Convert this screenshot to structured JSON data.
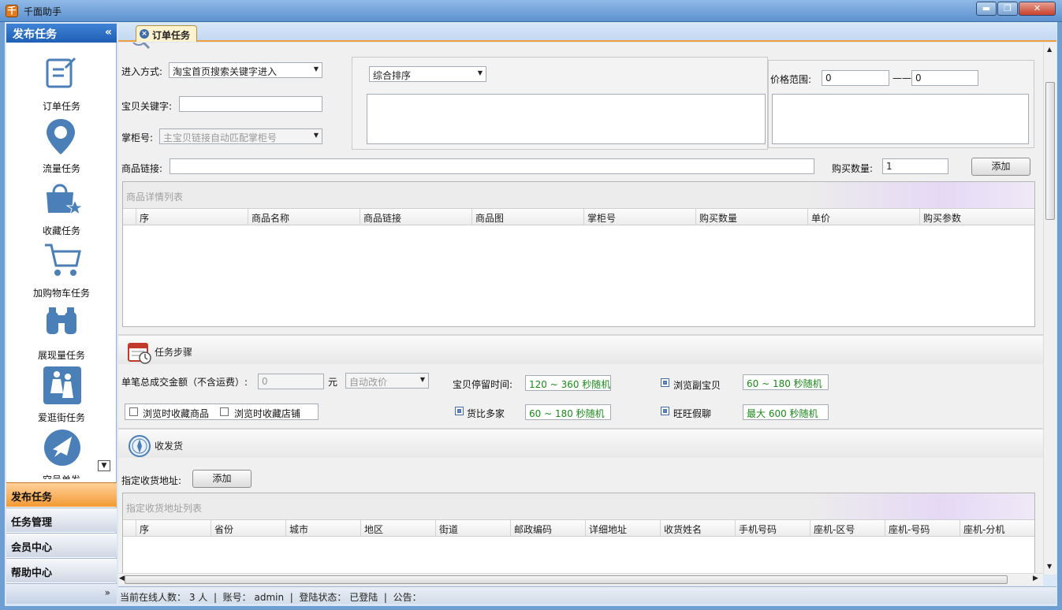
{
  "window": {
    "title": "千面助手",
    "icon_label": "千",
    "min": "▬",
    "max": "❐",
    "close": "✕"
  },
  "sidebar": {
    "header": "发布任务",
    "collapse": "«",
    "items": [
      {
        "label": "订单任务",
        "icon": "order-icon"
      },
      {
        "label": "流量任务",
        "icon": "location-pin-icon"
      },
      {
        "label": "收藏任务",
        "icon": "bag-star-icon"
      },
      {
        "label": "加购物车任务",
        "icon": "cart-icon"
      },
      {
        "label": "展现量任务",
        "icon": "binoculars-icon"
      },
      {
        "label": "爱逛街任务",
        "icon": "shoppers-icon"
      },
      {
        "label": "空号单发",
        "icon": "plane-icon"
      }
    ],
    "nav": [
      "发布任务",
      "任务管理",
      "会员中心",
      "帮助中心"
    ],
    "expand": "»"
  },
  "tab": {
    "label": "订单任务",
    "close": "×"
  },
  "search": {
    "entry_label": "进入方式:",
    "entry_value": "淘宝首页搜索关键字进入",
    "keyword_label": "宝贝关键字:",
    "keyword_value": "",
    "shop_label": "掌柜号:",
    "shop_placeholder": "主宝贝链接自动匹配掌柜号",
    "sort_value": "综合排序",
    "price_label": "价格范围:",
    "price_min": "0",
    "price_dash": "——",
    "price_max": "0",
    "link_label": "商品链接:",
    "link_value": "",
    "qty_label": "购买数量:",
    "qty_value": "1",
    "add_button": "添加"
  },
  "product_grid": {
    "title": "商品详情列表",
    "columns": [
      "序",
      "商品名称",
      "商品链接",
      "商品图",
      "掌柜号",
      "购买数量",
      "单价",
      "购买参数"
    ]
  },
  "steps": {
    "title": "任务步骤",
    "amount_label": "单笔总成交金额（不含运费）:",
    "amount_value": "0",
    "amount_unit": "元",
    "price_mode": "自动改价",
    "browse_goods": "浏览时收藏商品",
    "browse_shop": "浏览时收藏店铺",
    "stay_label": "宝贝停留时间:",
    "stay_value": "120 ~ 360 秒随机",
    "compare_label": "货比多家",
    "compare_value": "60 ~ 180 秒随机",
    "sub_label": "浏览副宝贝",
    "sub_value": "60 ~ 180 秒随机",
    "chat_label": "旺旺假聊",
    "chat_value": "最大 600 秒随机"
  },
  "shipping": {
    "title": "收发货",
    "address_label": "指定收货地址:",
    "add_button": "添加",
    "grid_title": "指定收货地址列表",
    "columns": [
      "序",
      "省份",
      "城市",
      "地区",
      "街道",
      "邮政编码",
      "详细地址",
      "收货姓名",
      "手机号码",
      "座机-区号",
      "座机-号码",
      "座机-分机"
    ]
  },
  "status": {
    "online_label": "当前在线人数：",
    "online_value": "3 人",
    "sep": "|",
    "account_label": "账号：",
    "account_value": "admin",
    "login_label": "登陆状态：",
    "login_value": "已登陆",
    "notice_label": "公告："
  }
}
